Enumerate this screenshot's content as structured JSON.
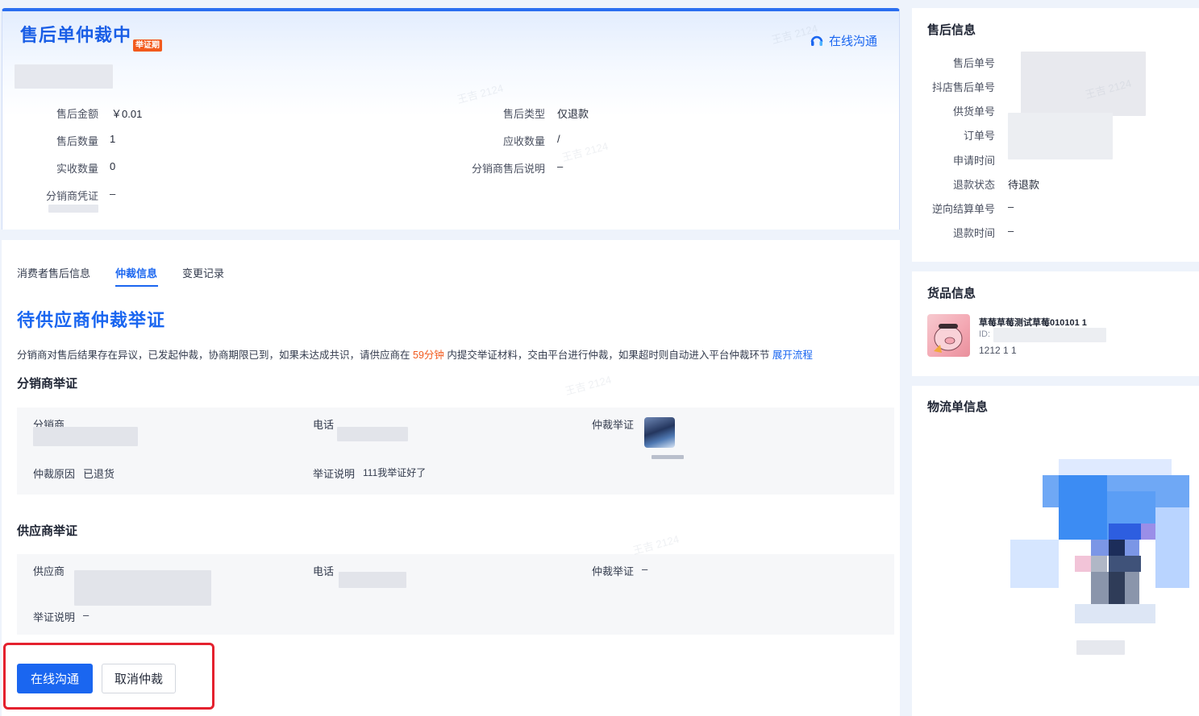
{
  "status": {
    "title": "售后单仲裁中",
    "badge": "举证期",
    "online_chat": "在线沟通"
  },
  "summary": {
    "left": [
      {
        "label": "售后金额",
        "value": "￥0.01"
      },
      {
        "label": "售后数量",
        "value": "1"
      },
      {
        "label": "实收数量",
        "value": "0"
      },
      {
        "label": "分销商凭证",
        "value": "–"
      }
    ],
    "right": [
      {
        "label": "售后类型",
        "value": "仅退款"
      },
      {
        "label": "应收数量",
        "value": "/"
      },
      {
        "label": "分销商售后说明",
        "value": "–"
      }
    ]
  },
  "tabs": [
    {
      "label": "消费者售后信息",
      "active": false
    },
    {
      "label": "仲裁信息",
      "active": true
    },
    {
      "label": "变更记录",
      "active": false
    }
  ],
  "arbitration": {
    "title": "待供应商仲裁举证",
    "notice_prefix": "分销商对售后结果存在异议，已发起仲裁，协商期限已到，如果未达成共识，请供应商在",
    "notice_highlight": "59分钟",
    "notice_suffix": "内提交举证材料，交由平台进行仲裁，如果超时则自动进入平台仲裁环节",
    "notice_link": "展开流程",
    "distributor": {
      "title": "分销商举证",
      "name_label": "分销商",
      "phone_label": "电话",
      "evidence_label": "仲裁举证",
      "reason_label": "仲裁原因",
      "reason_value": "已退货",
      "desc_label": "举证说明",
      "desc_value": "111我举证好了"
    },
    "supplier": {
      "title": "供应商举证",
      "name_label": "供应商",
      "phone_label": "电话",
      "evidence_label": "仲裁举证",
      "evidence_value": "–",
      "desc_label": "举证说明",
      "desc_value": "–"
    }
  },
  "actions": {
    "chat": "在线沟通",
    "cancel": "取消仲裁"
  },
  "after_sale_info": {
    "title": "售后信息",
    "rows": [
      {
        "label": "售后单号",
        "value": ""
      },
      {
        "label": "抖店售后单号",
        "value": ""
      },
      {
        "label": "供货单号",
        "value": ""
      },
      {
        "label": "订单号",
        "value": ""
      },
      {
        "label": "申请时间",
        "value": ""
      },
      {
        "label": "退款状态",
        "value": "待退款"
      },
      {
        "label": "逆向结算单号",
        "value": "–"
      },
      {
        "label": "退款时间",
        "value": "–"
      }
    ]
  },
  "goods_info": {
    "title": "货品信息",
    "name": "草莓草莓测试草莓010101 1",
    "id_label": "ID:",
    "spec": "1212 1 1"
  },
  "logistics_info": {
    "title": "物流单信息"
  },
  "watermark_text": "王吉 2124",
  "colors": {
    "primary": "#1a66f0",
    "warning": "#f25a1d",
    "highlight_border": "#e4212e"
  }
}
